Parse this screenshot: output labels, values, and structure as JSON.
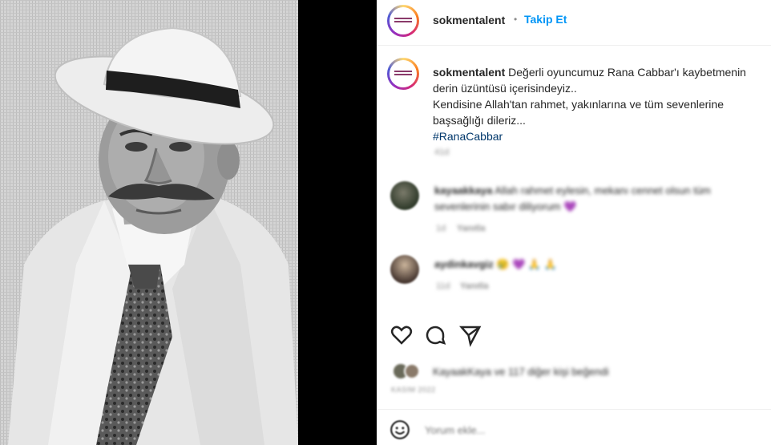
{
  "post": {
    "username": "sokmentalent",
    "separator": "•",
    "follow_label": "Takip Et",
    "caption": {
      "username": "sokmentalent",
      "line1": "Değerli oyuncumuz Rana Cabbar'ı kaybetmenin",
      "line2": "derin üzüntüsü içerisindeyiz..",
      "line3": "Kendisine Allah'tan rahmet, yakınlarına ve tüm sevenlerine",
      "line4": "başsağlığı dileriz...",
      "hashtag": "#RanaCabbar"
    },
    "time_ago": "41d"
  },
  "comments": [
    {
      "username": "kayaakkaya",
      "text_line1": "Allah rahmet eylesin, mekanı cennet olsun tüm",
      "text_line2": "sevenlerinin sabır diliyorum",
      "time": "1d",
      "reply_label": "Yanıtla",
      "emoji": "💜"
    },
    {
      "username": "aydinkavgiz",
      "emojis": "😢 💜 🙏 🙏",
      "time": "11d",
      "reply_label": "Yanıtla"
    }
  ],
  "likes": {
    "text": "KayaakKaya ve 117 diğer kişi beğendi",
    "date": "KASIM 2022"
  },
  "comment_box": {
    "placeholder": "Yorum ekle..."
  },
  "icons": {
    "like": "heart-icon",
    "comment": "comment-icon",
    "share": "share-icon",
    "emoji": "emoji-icon"
  },
  "colors": {
    "follow_blue": "#0095f6",
    "hashtag_blue": "#00376b",
    "muted": "#8e8e8e",
    "text": "#262626"
  }
}
